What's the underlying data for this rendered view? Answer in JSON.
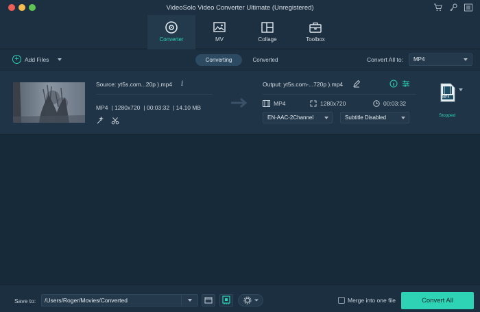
{
  "app": {
    "title": "VideoSolo Video Converter Ultimate (Unregistered)"
  },
  "colors": {
    "accent": "#2ed3b6",
    "background": "#172a3a",
    "panel": "#1f3446",
    "bar": "#1d3041"
  },
  "titlebar_icons": [
    "cart-icon",
    "key-icon",
    "menu-icon"
  ],
  "nav": {
    "items": [
      {
        "label": "Converter",
        "icon": "disc-icon",
        "active": true
      },
      {
        "label": "MV",
        "icon": "photo-icon",
        "active": false
      },
      {
        "label": "Collage",
        "icon": "collage-icon",
        "active": false
      },
      {
        "label": "Toolbox",
        "icon": "toolbox-icon",
        "active": false
      }
    ]
  },
  "toolbar": {
    "add_files": "Add Files",
    "tabs": [
      {
        "label": "Converting",
        "active": true
      },
      {
        "label": "Converted",
        "active": false
      }
    ],
    "convert_all_to": "Convert All to:",
    "format": "MP4"
  },
  "file": {
    "source": "Source: yt5s.com...20p ).mp4",
    "info": "i",
    "format": "MP4",
    "resolution": "1280x720",
    "duration": "00:03:32",
    "size": "14.10 MB",
    "output": "Output: yt5s.com-...720p ).mp4",
    "out_format": "MP4",
    "out_resolution": "1280x720",
    "out_duration": "00:03:32",
    "audio_track": "EN-AAC-2Channel",
    "subtitle": "Subtitle Disabled",
    "badge": "MP4",
    "status": "Stopped"
  },
  "bottom": {
    "save_to": "Save to:",
    "path": "/Users/Roger/Movies/Converted",
    "merge_label": "Merge into one file",
    "merge_checked": false,
    "convert_all": "Convert All"
  }
}
